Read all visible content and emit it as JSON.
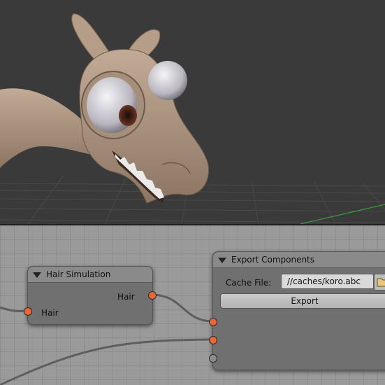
{
  "viewport": {
    "subject": "3D character model (cartoon horse head)"
  },
  "node_editor": {
    "nodes": {
      "hair_simulation": {
        "title": "Hair Simulation",
        "output_label": "Hair",
        "input_label": "Hair"
      },
      "export_components": {
        "title": "Export Components",
        "cache_file_label": "Cache File:",
        "cache_file_value": "//caches/koro.abc",
        "export_button_label": "Export"
      }
    },
    "colors": {
      "hair_socket": "#e8673a",
      "node_body": "#707070",
      "node_header": "#8a8a8a",
      "editor_background": "#9a9a9a"
    }
  }
}
